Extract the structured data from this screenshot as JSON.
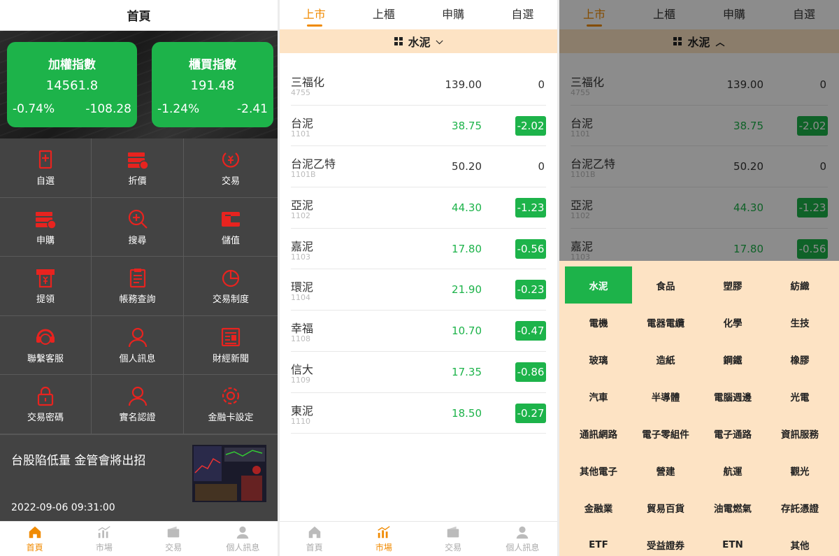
{
  "home": {
    "title": "首頁",
    "index_cards": [
      {
        "name": "加權指數",
        "value": "14561.8",
        "pct": "-0.74%",
        "change": "-108.28"
      },
      {
        "name": "櫃買指數",
        "value": "191.48",
        "pct": "-1.24%",
        "change": "-2.41"
      }
    ],
    "menu": [
      {
        "label": "自選",
        "icon": "bookmark-icon"
      },
      {
        "label": "折價",
        "icon": "discount-icon"
      },
      {
        "label": "交易",
        "icon": "trade-icon"
      },
      {
        "label": "申購",
        "icon": "subscribe-icon"
      },
      {
        "label": "搜尋",
        "icon": "search-icon"
      },
      {
        "label": "儲值",
        "icon": "wallet-icon"
      },
      {
        "label": "提領",
        "icon": "withdraw-icon"
      },
      {
        "label": "帳務查詢",
        "icon": "clipboard-icon"
      },
      {
        "label": "交易制度",
        "icon": "pie-chart-icon"
      },
      {
        "label": "聯繫客服",
        "icon": "headset-icon"
      },
      {
        "label": "個人訊息",
        "icon": "user-icon"
      },
      {
        "label": "財經新聞",
        "icon": "newspaper-icon"
      },
      {
        "label": "交易密碼",
        "icon": "lock-icon"
      },
      {
        "label": "實名認證",
        "icon": "user-verify-icon"
      },
      {
        "label": "金融卡設定",
        "icon": "gear-icon"
      }
    ],
    "news": {
      "title": "台股陷低量 金管會將出招",
      "date": "2022-09-06 09:31:00"
    }
  },
  "tabbar": {
    "items": [
      "首頁",
      "市場",
      "交易",
      "個人訊息"
    ]
  },
  "market": {
    "tabs": [
      "上市",
      "上櫃",
      "申購",
      "自選"
    ],
    "category": "水泥",
    "rows": [
      {
        "name": "三福化",
        "code": "4755",
        "price": "139.00",
        "change": "0",
        "dir": "flat"
      },
      {
        "name": "台泥",
        "code": "1101",
        "price": "38.75",
        "change": "-2.02",
        "dir": "down"
      },
      {
        "name": "台泥乙特",
        "code": "1101B",
        "price": "50.20",
        "change": "0",
        "dir": "flat"
      },
      {
        "name": "亞泥",
        "code": "1102",
        "price": "44.30",
        "change": "-1.23",
        "dir": "down"
      },
      {
        "name": "嘉泥",
        "code": "1103",
        "price": "17.80",
        "change": "-0.56",
        "dir": "down"
      },
      {
        "name": "環泥",
        "code": "1104",
        "price": "21.90",
        "change": "-0.23",
        "dir": "down"
      },
      {
        "name": "幸福",
        "code": "1108",
        "price": "10.70",
        "change": "-0.47",
        "dir": "down"
      },
      {
        "name": "信大",
        "code": "1109",
        "price": "17.35",
        "change": "-0.86",
        "dir": "down"
      },
      {
        "name": "東泥",
        "code": "1110",
        "price": "18.50",
        "change": "-0.27",
        "dir": "down"
      }
    ]
  },
  "dropdown": {
    "selected": "水泥",
    "categories": [
      "水泥",
      "食品",
      "塑膠",
      "紡織",
      "電機",
      "電器電纜",
      "化學",
      "生技",
      "玻璃",
      "造紙",
      "鋼鐵",
      "橡膠",
      "汽車",
      "半導體",
      "電腦週邊",
      "光電",
      "通訊網路",
      "電子零組件",
      "電子通路",
      "資訊服務",
      "其他電子",
      "營建",
      "航運",
      "觀光",
      "金融業",
      "貿易百貨",
      "油電燃氣",
      "存託憑證",
      "ETF",
      "受益證券",
      "ETN",
      "其他"
    ]
  },
  "colors": {
    "accent": "#f08a00",
    "green": "#1db34a",
    "cream": "#fde3c4",
    "icon_red": "#e8231f"
  }
}
